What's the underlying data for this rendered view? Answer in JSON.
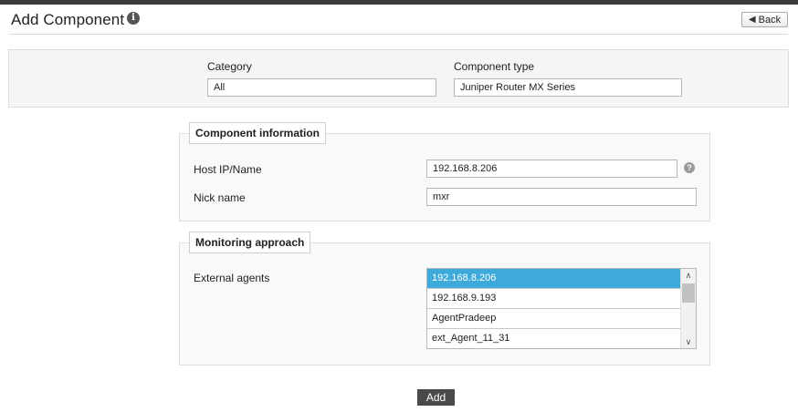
{
  "header": {
    "title": "Add Component",
    "back_label": "Back"
  },
  "selection": {
    "category_label": "Category",
    "category_value": "All",
    "component_type_label": "Component type",
    "component_type_value": "Juniper Router MX Series"
  },
  "component_information": {
    "legend": "Component information",
    "host_label": "Host IP/Name",
    "host_value": "192.168.8.206",
    "nick_label": "Nick name",
    "nick_value": "mxr"
  },
  "monitoring_approach": {
    "legend": "Monitoring approach",
    "external_agents_label": "External agents",
    "agents": [
      {
        "name": "192.168.8.206",
        "selected": true
      },
      {
        "name": "192.168.9.193",
        "selected": false
      },
      {
        "name": "AgentPradeep",
        "selected": false
      },
      {
        "name": "ext_Agent_11_31",
        "selected": false
      }
    ]
  },
  "actions": {
    "add_label": "Add"
  },
  "colors": {
    "selected_item": "#3eaadb",
    "topbar": "#3b3b3b",
    "add_button": "#4a4a4a"
  },
  "icons": {
    "title_info": "info-icon",
    "back": "back-arrow-icon",
    "host_help": "help-icon"
  }
}
